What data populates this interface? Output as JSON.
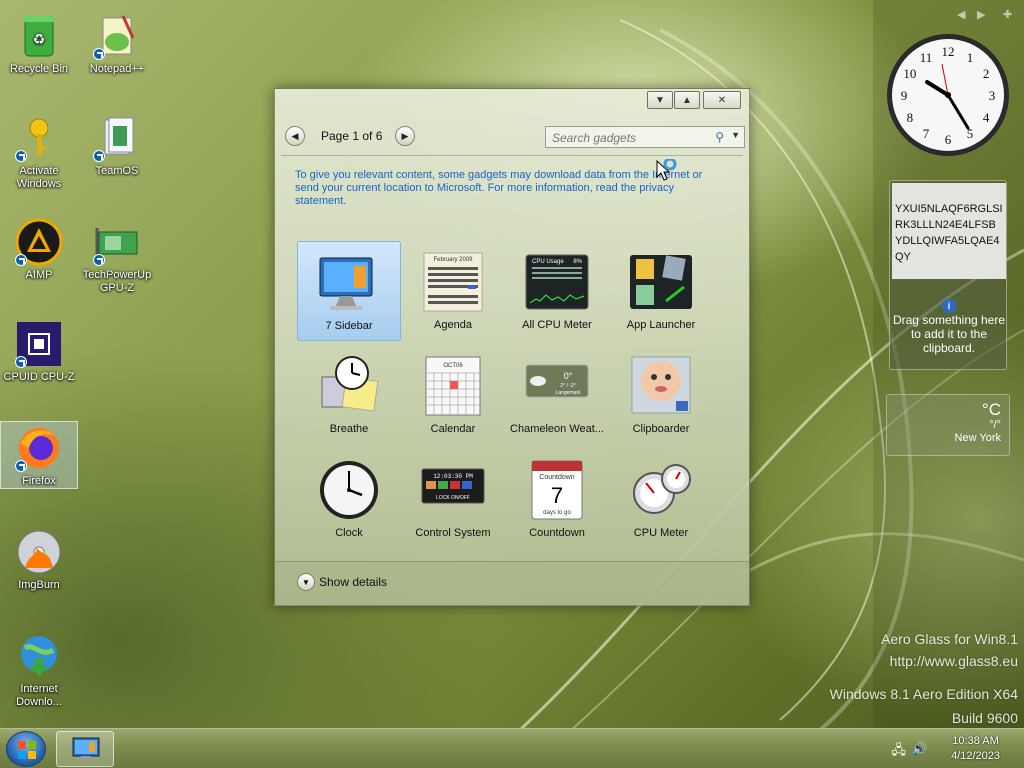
{
  "desktop": {
    "icons": [
      {
        "label": "Recycle Bin",
        "icon": "recycle-bin-icon"
      },
      {
        "label": "Notepad++",
        "icon": "notepadpp-icon"
      },
      {
        "label": "Activate Windows",
        "icon": "key-icon"
      },
      {
        "label": "TeamOS",
        "icon": "teamos-icon"
      },
      {
        "label": "AIMP",
        "icon": "aimp-icon"
      },
      {
        "label": "TechPowerUp GPU-Z",
        "icon": "gpuz-icon"
      },
      {
        "label": "CPUID CPU-Z",
        "icon": "cpuz-icon"
      },
      {
        "label": "Firefox",
        "icon": "firefox-icon"
      },
      {
        "label": "ImgBurn",
        "icon": "imgburn-icon"
      },
      {
        "label": "Internet Downlo...",
        "icon": "idm-icon"
      }
    ]
  },
  "gadget_window": {
    "page_label": "Page 1 of 6",
    "search_placeholder": "Search gadgets",
    "info_text": "To give you relevant content, some gadgets may download data from the Internet or send your current location to Microsoft. For more information, read the privacy statement.",
    "gadgets": [
      {
        "label": "7 Sidebar",
        "icon": "monitor-icon",
        "selected": true
      },
      {
        "label": "Agenda",
        "icon": "agenda-calendar-icon"
      },
      {
        "label": "All CPU Meter",
        "icon": "cpu-usage-icon"
      },
      {
        "label": "App Launcher",
        "icon": "app-launcher-icon"
      },
      {
        "label": "Breathe",
        "icon": "breathe-clock-icon"
      },
      {
        "label": "Calendar",
        "icon": "calendar-icon"
      },
      {
        "label": "Chameleon Weat...",
        "icon": "weather-icon"
      },
      {
        "label": "Clipboarder",
        "icon": "clipboarder-icon"
      },
      {
        "label": "Clock",
        "icon": "clock-icon"
      },
      {
        "label": "Control System",
        "icon": "control-system-icon"
      },
      {
        "label": "Countdown",
        "icon": "countdown-icon"
      },
      {
        "label": "CPU Meter",
        "icon": "cpu-meter-icon"
      }
    ],
    "agenda_month": "February 2009",
    "cpu_usage_title": "CPU Usage",
    "cpu_usage_pct": "8%",
    "weather_temp": "0°",
    "weather_range": "2° / -2°",
    "weather_city": "Langemark",
    "control_time": "12:03:30 PM",
    "control_lock": "LOCK ON/OFF",
    "countdown_title": "Countdown",
    "countdown_days": "7",
    "countdown_sub": "days to go",
    "calendar_month": "OCT06",
    "show_details": "Show details"
  },
  "sidebar": {
    "clipboard_text": "YXUI5NLAQF6RGLSIRK3LLLN24E4LFSBYDLLQIWFA5LQAE4QY",
    "clipboard_hint": "Drag something here to add it to the clipboard.",
    "weather_unit": "°C",
    "weather_range": "°/°",
    "weather_city": "New York",
    "clock_numbers": [
      "12",
      "1",
      "2",
      "3",
      "4",
      "5",
      "6",
      "7",
      "8",
      "9",
      "10",
      "11"
    ]
  },
  "watermark": {
    "line1": "Aero Glass for Win8.1",
    "line2": "http://www.glass8.eu",
    "line3": "Windows 8.1 Aero Edition X64",
    "line4": "Build 9600"
  },
  "taskbar": {
    "time": "10:38 AM",
    "date": "4/12/2023"
  },
  "colors": {
    "link_blue": "#1a63c5",
    "selection_blue": "#a7cdef",
    "wallpaper_green": "#7d8f3f"
  }
}
